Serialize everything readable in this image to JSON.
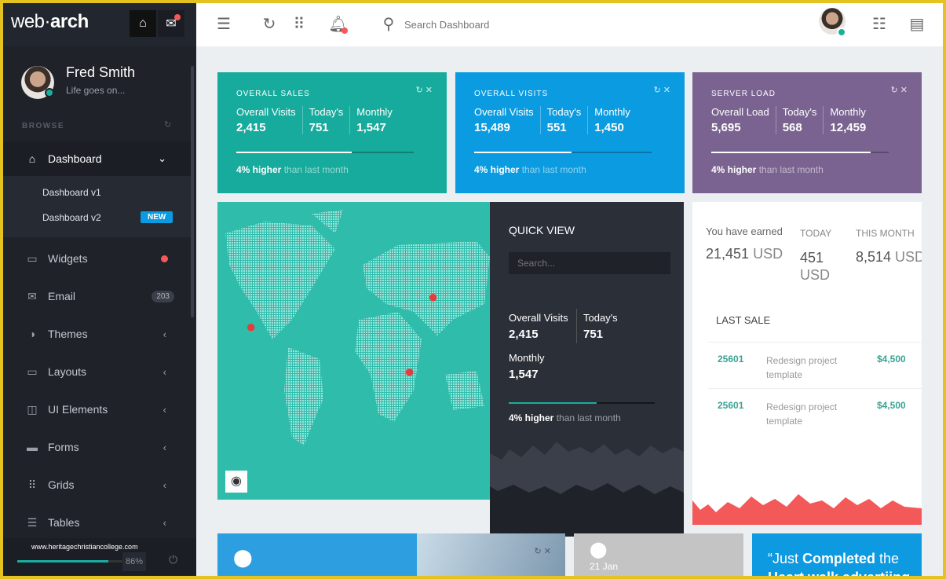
{
  "brand": {
    "logo_light": "web",
    "logo_bold": "arch"
  },
  "user": {
    "name": "Fred Smith",
    "status": "Life goes on..."
  },
  "sidebar": {
    "section": "BROWSE",
    "items": [
      {
        "label": "Dashboard",
        "icon": "home-icon"
      },
      {
        "label": "Widgets",
        "icon": "widgets-icon"
      },
      {
        "label": "Email",
        "icon": "email-icon",
        "badge": "203"
      },
      {
        "label": "Themes",
        "icon": "themes-icon"
      },
      {
        "label": "Layouts",
        "icon": "layouts-icon"
      },
      {
        "label": "UI Elements",
        "icon": "ui-elements-icon"
      },
      {
        "label": "Forms",
        "icon": "forms-icon"
      },
      {
        "label": "Grids",
        "icon": "grids-icon"
      },
      {
        "label": "Tables",
        "icon": "tables-icon"
      }
    ],
    "sub": [
      {
        "label": "Dashboard v1"
      },
      {
        "label": "Dashboard v2",
        "badge": "NEW"
      }
    ],
    "progress": "86%",
    "progress_value": 86,
    "watermark": "www.heritagechristiancollege.com"
  },
  "topbar": {
    "search_placeholder": "Search Dashboard"
  },
  "stats": [
    {
      "title": "OVERALL SALES",
      "color": "#16ab9c",
      "cols": [
        {
          "l": "Overall Visits",
          "v": "2,415"
        },
        {
          "l": "Today's",
          "v": "751"
        },
        {
          "l": "Monthly",
          "v": "1,547"
        }
      ],
      "progress": 65,
      "higher": "4% higher",
      "rest": " than last month"
    },
    {
      "title": "OVERALL VISITS",
      "color": "#0b9be0",
      "cols": [
        {
          "l": "Overall Visits",
          "v": "15,489"
        },
        {
          "l": "Today's",
          "v": "551"
        },
        {
          "l": "Monthly",
          "v": "1,450"
        }
      ],
      "progress": 55,
      "higher": "4% higher",
      "rest": " than last month"
    },
    {
      "title": "SERVER LOAD",
      "color": "#7a6390",
      "cols": [
        {
          "l": "Overall Load",
          "v": "5,695"
        },
        {
          "l": "Today's",
          "v": "568"
        },
        {
          "l": "Monthly",
          "v": "12,459"
        }
      ],
      "progress": 90,
      "higher": "4% higher",
      "rest": " than last month"
    }
  ],
  "quick": {
    "title": "QUICK VIEW",
    "search_placeholder": "Search...",
    "c1l": "Overall Visits",
    "c1v": "2,415",
    "c2l": "Today's",
    "c2v": "751",
    "c3l": "Monthly",
    "c3v": "1,547",
    "progress": 60,
    "higher": "4% higher",
    "rest": " than last month"
  },
  "earn": {
    "l1": "You have earned",
    "v1": "21,451",
    "u1": " USD",
    "l2": "TODAY",
    "v2": "451",
    "u2": "USD",
    "l3": "THIS MONTH",
    "v3": "8,514",
    "u3": " USD",
    "last_sale": "LAST SALE",
    "sales": [
      {
        "id": "25601",
        "desc": "Redesign project template",
        "amt": "$4,500"
      },
      {
        "id": "25601",
        "desc": "Redesign project template",
        "amt": "$4,500"
      }
    ]
  },
  "bottom": {
    "date": "21 Jan",
    "quote_open": "“Just ",
    "quote_bold": "Completed",
    "quote_rest": " the",
    "quote_line2": "Heart walk advertiing"
  }
}
